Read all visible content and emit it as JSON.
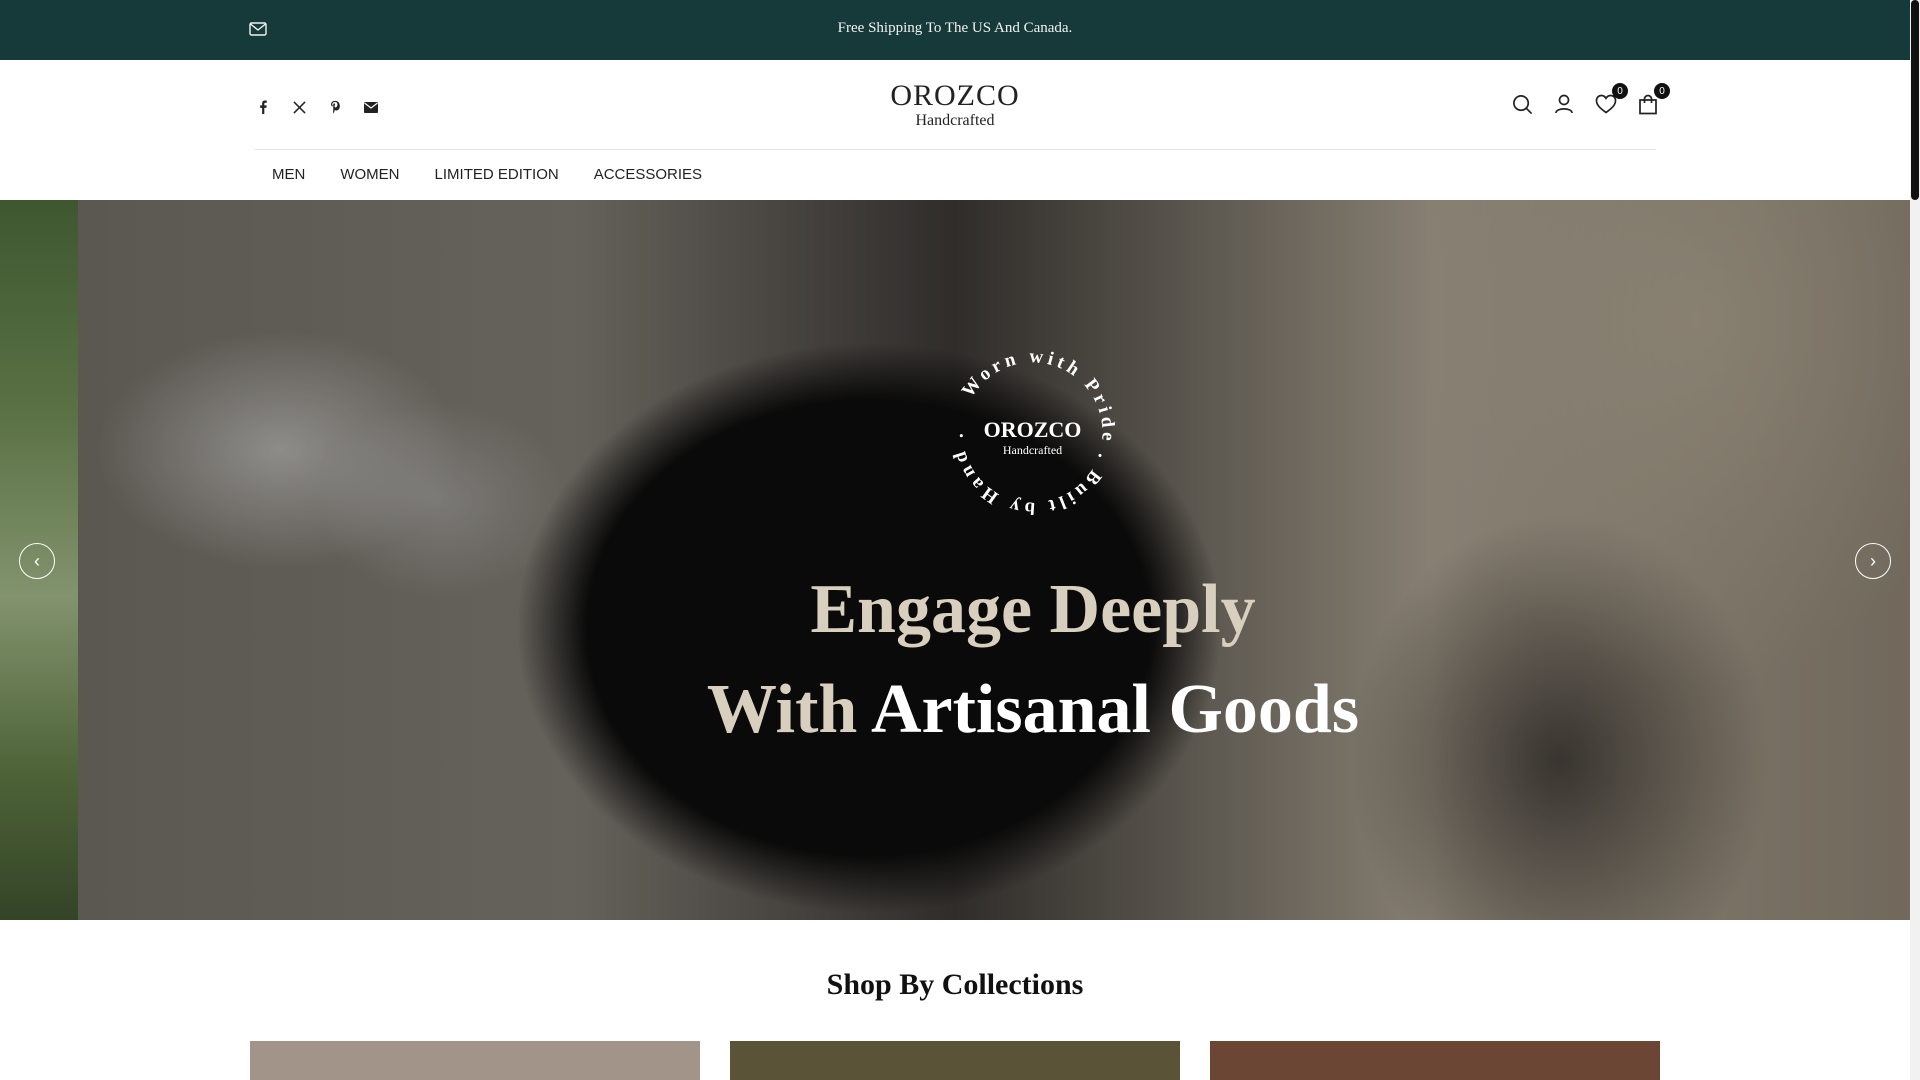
{
  "announcement": {
    "text": "Free Shipping To The US And Canada.",
    "icon": "mail-icon"
  },
  "header": {
    "logo": {
      "main": "OROZCO",
      "sub": "Handcrafted"
    },
    "socials": [
      "facebook-icon",
      "x-icon",
      "pinterest-icon",
      "email-icon"
    ],
    "wishlist_count": "0",
    "cart_count": "0"
  },
  "nav": {
    "items": [
      "MEN",
      "WOMEN",
      "LIMITED EDITION",
      "ACCESSORIES"
    ]
  },
  "hero": {
    "badge": {
      "brand": "OROZCO",
      "sub": "Handcrafted",
      "ring_text": "Worn with Pride . Built by Hand ."
    },
    "title_line1": "Engage Deeply",
    "title_line2_a": "With",
    "title_line2_b": "Artisanal Goods",
    "prev": "‹",
    "next": "›"
  },
  "collections": {
    "title": "Shop By Collections",
    "card_colors": [
      "#a29488",
      "#5a5338",
      "#6b4635"
    ]
  },
  "colors": {
    "accent": "#163a3a",
    "cream": "#d9cfbf"
  }
}
